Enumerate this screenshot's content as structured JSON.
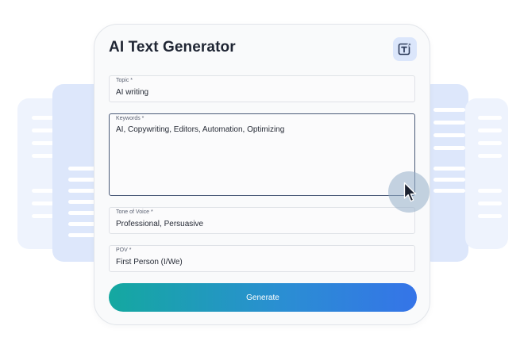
{
  "app": {
    "title": "AI Text Generator",
    "title_icon": "text-sparkle-icon"
  },
  "form": {
    "topic": {
      "label": "Topic *",
      "value": "AI writing"
    },
    "keywords": {
      "label": "Keywords *",
      "value": "AI, Copywriting, Editors, Automation, Optimizing"
    },
    "tone": {
      "label": "Tone of Voice *",
      "value": "Professional, Persuasive"
    },
    "pov": {
      "label": "POV *",
      "value": "First Person (I/We)"
    }
  },
  "actions": {
    "generate_label": "Generate"
  },
  "colors": {
    "accent_start": "#14a8a0",
    "accent_end": "#3574e8",
    "icon_bg": "#dbe6fb",
    "doc_bg": "#dde7fb"
  }
}
